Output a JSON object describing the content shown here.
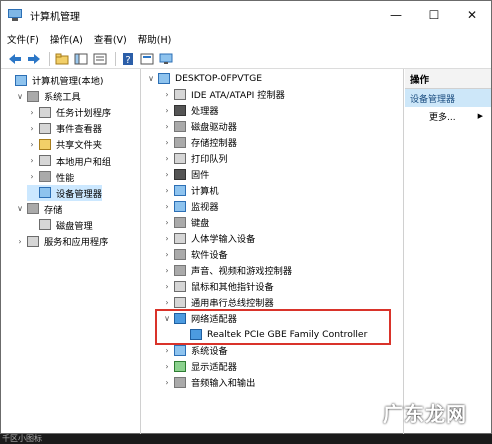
{
  "window": {
    "title": "计算机管理",
    "controls": {
      "minimize": "—",
      "maximize": "☐",
      "close": "✕"
    }
  },
  "menu": [
    "文件(F)",
    "操作(A)",
    "查看(V)",
    "帮助(H)"
  ],
  "left_tree": [
    {
      "label": "计算机管理(本地)",
      "level": 0,
      "chev": "",
      "icon": "computer-management-icon"
    },
    {
      "label": "系统工具",
      "level": 1,
      "chev": "∨",
      "icon": "system-tools-icon"
    },
    {
      "label": "任务计划程序",
      "level": 2,
      "chev": "›",
      "icon": "task-scheduler-icon"
    },
    {
      "label": "事件查看器",
      "level": 2,
      "chev": "›",
      "icon": "event-viewer-icon"
    },
    {
      "label": "共享文件夹",
      "level": 2,
      "chev": "›",
      "icon": "shared-folder-icon"
    },
    {
      "label": "本地用户和组",
      "level": 2,
      "chev": "›",
      "icon": "users-icon"
    },
    {
      "label": "性能",
      "level": 2,
      "chev": "›",
      "icon": "performance-icon"
    },
    {
      "label": "设备管理器",
      "level": 2,
      "chev": "",
      "icon": "device-manager-icon"
    },
    {
      "label": "存储",
      "level": 1,
      "chev": "∨",
      "icon": "storage-icon"
    },
    {
      "label": "磁盘管理",
      "level": 2,
      "chev": "",
      "icon": "disk-management-icon"
    },
    {
      "label": "服务和应用程序",
      "level": 1,
      "chev": "›",
      "icon": "services-icon"
    }
  ],
  "device_tree": {
    "root": "DESKTOP-0FPVTGE",
    "items": [
      {
        "label": "IDE ATA/ATAPI 控制器",
        "icon": "ide-controller-icon",
        "style": "generic"
      },
      {
        "label": "处理器",
        "icon": "processor-icon",
        "style": "dark"
      },
      {
        "label": "磁盘驱动器",
        "icon": "disk-drive-icon",
        "style": "gray"
      },
      {
        "label": "存储控制器",
        "icon": "storage-controller-icon",
        "style": "gray"
      },
      {
        "label": "打印队列",
        "icon": "print-queue-icon",
        "style": "generic"
      },
      {
        "label": "固件",
        "icon": "firmware-icon",
        "style": "dark"
      },
      {
        "label": "计算机",
        "icon": "computer-icon",
        "style": "screen"
      },
      {
        "label": "监视器",
        "icon": "monitor-icon",
        "style": "screen"
      },
      {
        "label": "键盘",
        "icon": "keyboard-icon",
        "style": "gray"
      },
      {
        "label": "人体学输入设备",
        "icon": "hid-icon",
        "style": "generic"
      },
      {
        "label": "软件设备",
        "icon": "software-device-icon",
        "style": "gray"
      },
      {
        "label": "声音、视频和游戏控制器",
        "icon": "audio-icon",
        "style": "gray"
      },
      {
        "label": "鼠标和其他指针设备",
        "icon": "mouse-icon",
        "style": "generic"
      },
      {
        "label": "通用串行总线控制器",
        "icon": "usb-icon",
        "style": "generic"
      },
      {
        "label": "网络适配器",
        "icon": "network-adapter-icon",
        "style": "net",
        "expanded": true
      },
      {
        "label": "Realtek PCIe GBE Family Controller",
        "icon": "network-card-icon",
        "style": "net",
        "child": true
      },
      {
        "label": "系统设备",
        "icon": "system-device-icon",
        "style": "screen"
      },
      {
        "label": "显示适配器",
        "icon": "display-adapter-icon",
        "style": "green"
      },
      {
        "label": "音频输入和输出",
        "icon": "audio-io-icon",
        "style": "gray"
      }
    ]
  },
  "actions": {
    "header": "操作",
    "selected": "设备管理器",
    "more": "更多...",
    "more_arrow": "▶"
  },
  "watermark": "广东龙网",
  "statusbar": "千区小图标"
}
